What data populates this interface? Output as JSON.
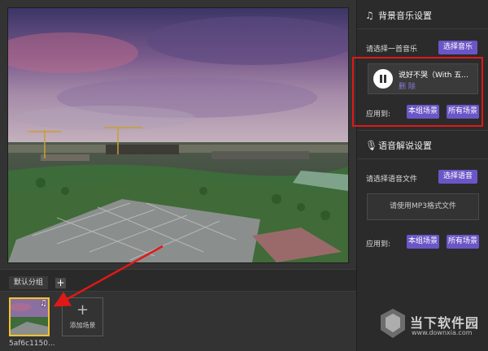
{
  "left_panel": {
    "group_tab_label": "默认分组",
    "add_group_label": "+",
    "scenes": [
      {
        "name": "5af6c1150...",
        "music_icon": "music-note-icon"
      }
    ],
    "add_scene": {
      "plus": "+",
      "label": "添加场景"
    }
  },
  "bg_music": {
    "title": "背景音乐设置",
    "icon": "music-note-icon",
    "select_label": "请选择一首音乐",
    "select_button": "选择音乐",
    "song": {
      "title": "说好不哭（With 五...",
      "delete_label": "删 除",
      "state": "playing"
    },
    "apply_label": "应用到:",
    "apply_group_button": "本组场景",
    "apply_all_button": "所有场景"
  },
  "narration": {
    "title": "语音解说设置",
    "icon": "microphone-icon",
    "select_label": "请选择语音文件",
    "select_button": "选择语音",
    "file_placeholder": "请使用MP3格式文件",
    "apply_label": "应用到:",
    "apply_group_button": "本组场景",
    "apply_all_button": "所有场景"
  },
  "watermark": {
    "brand": "当下软件园",
    "url": "www.downxia.com"
  },
  "colors": {
    "accent_purple": "#6b56c7",
    "highlight_red": "#e01818",
    "selected_yellow": "#f2c230"
  }
}
